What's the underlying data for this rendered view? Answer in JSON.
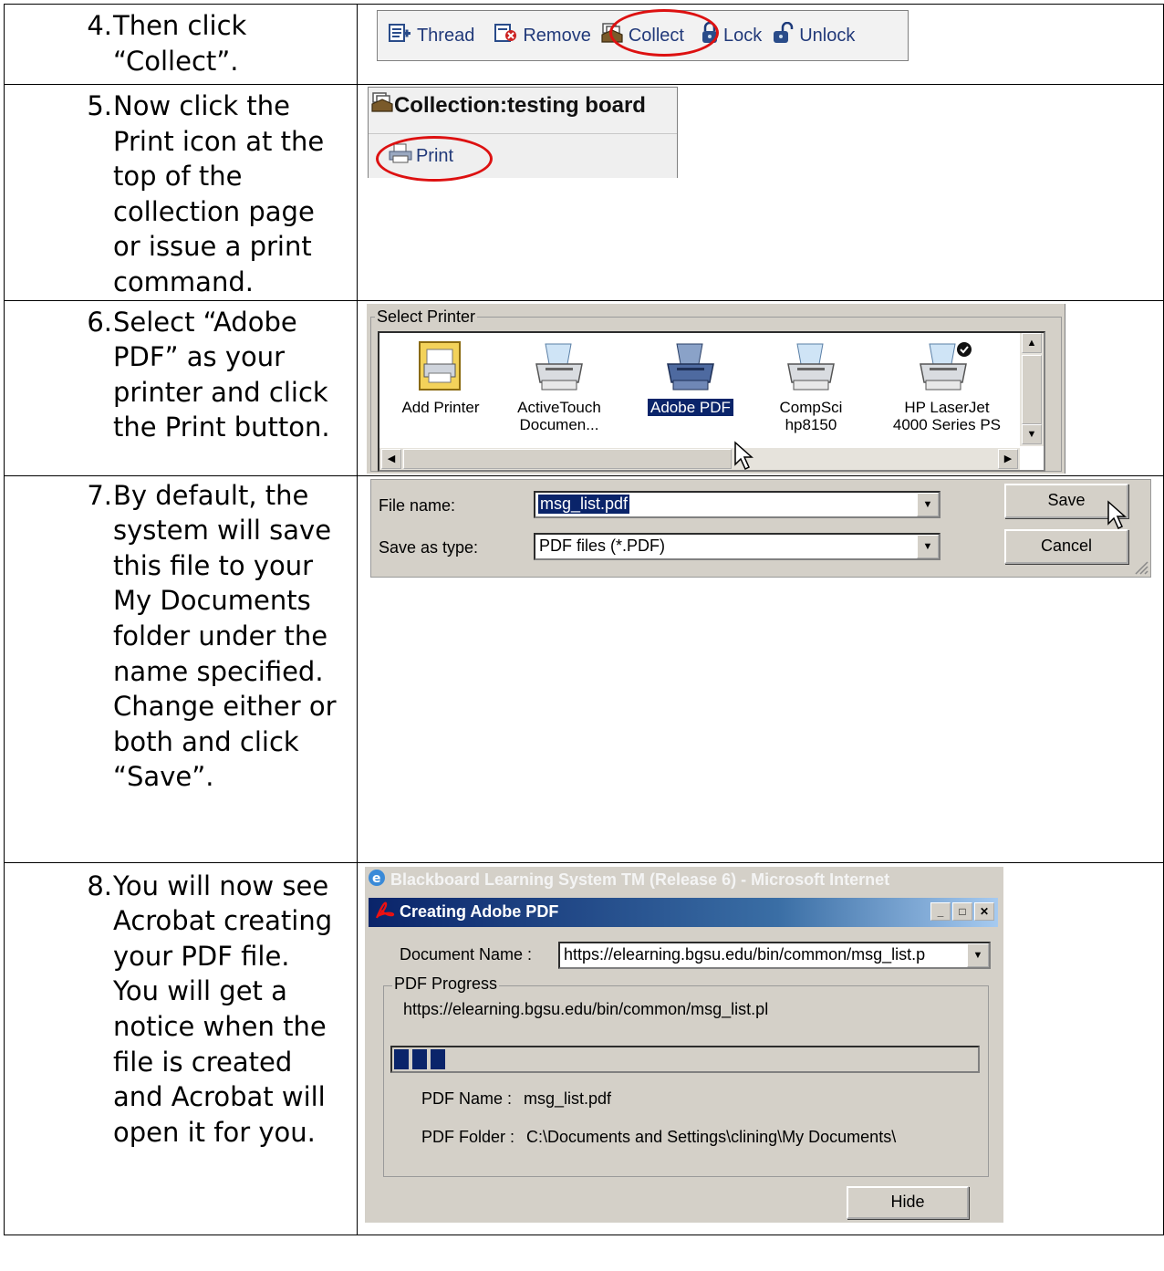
{
  "steps": [
    {
      "number": "4.",
      "text": "Then click “Collect”."
    },
    {
      "number": "5.",
      "text": "Now click the Print icon at the top of the collection page or issue a print command."
    },
    {
      "number": "6.",
      "text": "Select “Adobe PDF” as your printer and click the Print button."
    },
    {
      "number": "7.",
      "text": "By default, the system will save this file to your My Documents folder under the name specified. Change either or both and click “Save”."
    },
    {
      "number": "8.",
      "text": "You will now see Acrobat creating your PDF file.  You will get a notice when the file is created and Acrobat will open it for you."
    }
  ],
  "toolbar": {
    "thread": "Thread",
    "remove": "Remove",
    "collect": "Collect",
    "lock": "Lock",
    "unlock": "Unlock"
  },
  "collection": {
    "title": "Collection:testing board",
    "print": "Print"
  },
  "select_printer": {
    "group_label": "Select Printer",
    "printers": [
      {
        "line1": "Add Printer",
        "line2": ""
      },
      {
        "line1": "ActiveTouch",
        "line2": "Documen..."
      },
      {
        "line1": "Adobe PDF",
        "line2": ""
      },
      {
        "line1": "CompSci",
        "line2": "hp8150"
      },
      {
        "line1": "HP LaserJet",
        "line2": "4000 Series PS"
      }
    ],
    "selected": "Adobe PDF"
  },
  "save_dialog": {
    "file_name_label": "File name:",
    "file_name_value": "msg_list.pdf",
    "save_as_type_label": "Save as type:",
    "save_as_type_value": "PDF files (*.PDF)",
    "save_button": "Save",
    "cancel_button": "Cancel"
  },
  "acrobat": {
    "browser_title": "Blackboard Learning System TM (Release 6) - Microsoft Internet",
    "window_title": "Creating Adobe PDF",
    "document_name_label": "Document Name :",
    "document_name_value": "https://elearning.bgsu.edu/bin/common/msg_list.p",
    "progress_label": "PDF Progress",
    "progress_url": "https://elearning.bgsu.edu/bin/common/msg_list.pl",
    "progress_segments": 3,
    "pdf_name_label": "PDF Name :",
    "pdf_name_value": "msg_list.pdf",
    "pdf_folder_label": "PDF Folder :",
    "pdf_folder_value": "C:\\Documents and Settings\\clining\\My Documents\\",
    "hide_button": "Hide"
  },
  "colors": {
    "highlight_oval": "#dd1111",
    "selection": "#0a246a",
    "dialog_face": "#d4d0c8"
  }
}
